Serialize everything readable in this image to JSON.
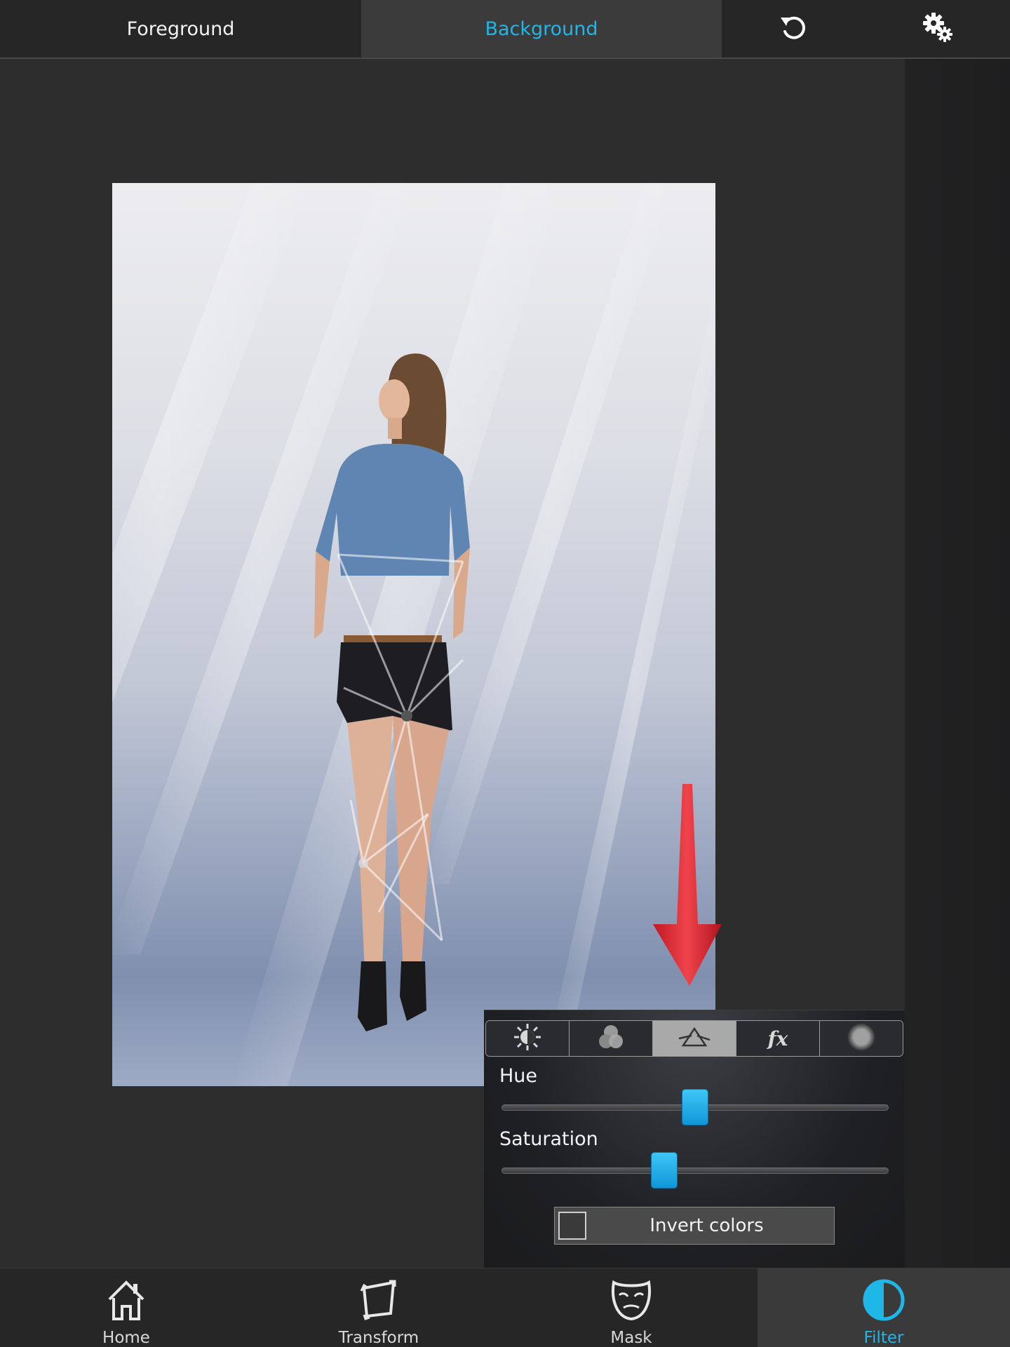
{
  "top_bar": {
    "tab_foreground": "Foreground",
    "tab_background": "Background",
    "active_tab": "Background",
    "undo_icon": "undo-icon",
    "settings_icon": "gears-icon"
  },
  "filter_panel": {
    "tabs": [
      {
        "icon": "brightness-icon",
        "active": false
      },
      {
        "icon": "color-channels-icon",
        "active": false
      },
      {
        "icon": "prism-hue-icon",
        "active": true
      },
      {
        "icon": "fx-icon",
        "active": false
      },
      {
        "icon": "blur-icon",
        "active": false
      }
    ],
    "fx_glyph": "fx",
    "hue": {
      "label": "Hue",
      "value": 0.5
    },
    "saturation": {
      "label": "Saturation",
      "value": 0.42
    },
    "invert": {
      "label": "Invert colors",
      "checked": false
    }
  },
  "bottom_nav": {
    "items": [
      {
        "label": "Home",
        "icon": "home-icon"
      },
      {
        "label": "Transform",
        "icon": "transform-icon"
      },
      {
        "label": "Mask",
        "icon": "mask-icon"
      },
      {
        "label": "Filter",
        "icon": "filter-icon"
      }
    ],
    "active": "Filter"
  },
  "colors": {
    "accent": "#1fb6e8",
    "background": "#2d2d2e",
    "arrow": "#e8323c"
  }
}
